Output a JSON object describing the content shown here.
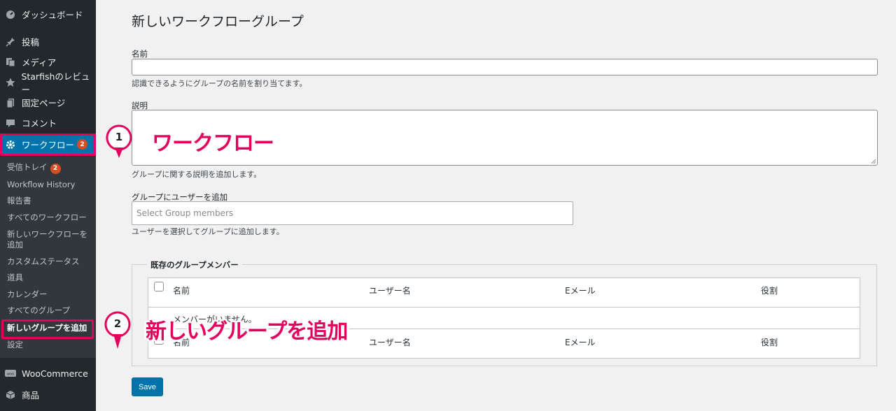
{
  "sidebar": {
    "menu": [
      {
        "label": "ダッシュボード",
        "icon": "dashboard-icon"
      },
      {
        "label": "投稿",
        "icon": "pin-icon"
      },
      {
        "label": "メディア",
        "icon": "media-icon"
      },
      {
        "label": "Starfishのレビュー",
        "icon": "star-icon"
      },
      {
        "label": "固定ページ",
        "icon": "page-icon"
      },
      {
        "label": "コメント",
        "icon": "comment-icon"
      },
      {
        "label": "ワークフロー",
        "icon": "gear-icon",
        "badge": "2"
      }
    ],
    "submenu": [
      {
        "label": "受信トレイ",
        "badge": "2"
      },
      {
        "label": "Workflow History"
      },
      {
        "label": "報告書"
      },
      {
        "label": "すべてのワークフロー"
      },
      {
        "label": "新しいワークフローを追加"
      },
      {
        "label": "カスタムステータス"
      },
      {
        "label": "道具"
      },
      {
        "label": "カレンダー"
      },
      {
        "label": "すべてのグループ"
      },
      {
        "label": "新しいグループを追加"
      },
      {
        "label": "設定"
      }
    ],
    "bottom_menu": [
      {
        "label": "WooCommerce",
        "icon": "woo-icon"
      },
      {
        "label": "商品",
        "icon": "product-icon"
      }
    ]
  },
  "main": {
    "title": "新しいワークフローグループ",
    "name_label": "名前",
    "name_value": "",
    "name_desc": "認識できるようにグループの名前を割り当てます。",
    "desc_label": "説明",
    "desc_value": "",
    "desc_desc": "グループに関する説明を追加します。",
    "members_label": "グループにユーザーを追加",
    "members_placeholder": "Select Group members",
    "members_desc": "ユーザーを選択してグループに追加します。",
    "existing_legend": "既存のグループメンバー",
    "table": {
      "headers": [
        "名前",
        "ユーザー名",
        "Eメール",
        "役割"
      ],
      "empty_text": "メンバーがいません。",
      "footers": [
        "名前",
        "ユーザー名",
        "Eメール",
        "役割"
      ]
    },
    "save_label": "Save"
  },
  "annotations": {
    "step1_number": "1",
    "step1_text": "ワークフロー",
    "step2_number": "2",
    "step2_text": "新しいグループを追加",
    "accent_color": "#e3005c"
  }
}
